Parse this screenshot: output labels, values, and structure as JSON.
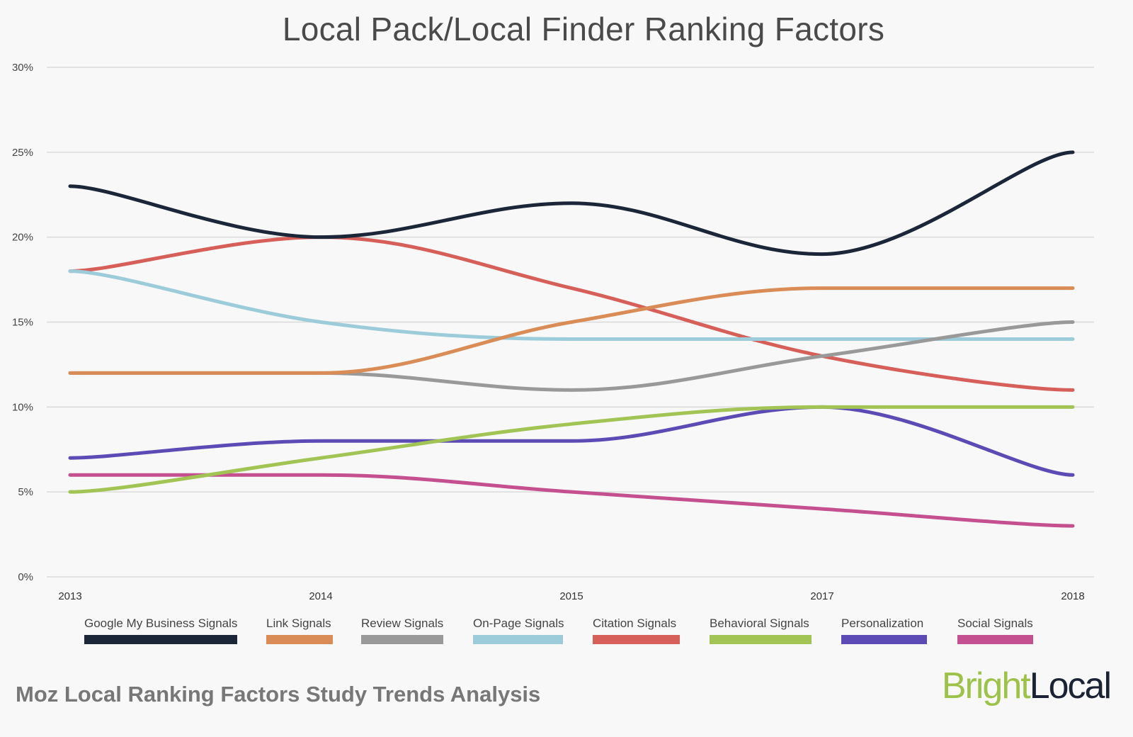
{
  "chart_data": {
    "type": "line",
    "title": "Local Pack/Local Finder Ranking Factors",
    "subtitle": "Moz Local Ranking Factors Study Trends Analysis",
    "xlabel": "",
    "ylabel": "",
    "x": [
      "2013",
      "2014",
      "2015",
      "2017",
      "2018"
    ],
    "y_ticks": [
      "0%",
      "5%",
      "10%",
      "15%",
      "20%",
      "25%",
      "30%"
    ],
    "y_tick_values": [
      0,
      5,
      10,
      15,
      20,
      25,
      30
    ],
    "ylim": [
      0,
      30
    ],
    "grid": true,
    "smooth": true,
    "legend_position": "bottom",
    "series": [
      {
        "name": "Google My Business Signals",
        "color": "#1b2638",
        "values": [
          23,
          20,
          22,
          19,
          25
        ]
      },
      {
        "name": "Link Signals",
        "color": "#d98c56",
        "values": [
          12,
          12,
          15,
          17,
          17
        ]
      },
      {
        "name": "Review Signals",
        "color": "#999999",
        "values": [
          12,
          12,
          11,
          13,
          15
        ]
      },
      {
        "name": "On-Page Signals",
        "color": "#9ccbd9",
        "values": [
          18,
          15,
          14,
          14,
          14
        ]
      },
      {
        "name": "Citation Signals",
        "color": "#d65f5a",
        "values": [
          18,
          20,
          17,
          13,
          11
        ]
      },
      {
        "name": "Behavioral Signals",
        "color": "#a2c455",
        "values": [
          5,
          7,
          9,
          10,
          10
        ]
      },
      {
        "name": "Personalization",
        "color": "#5d4bb5",
        "values": [
          7,
          8,
          8,
          10,
          6
        ]
      },
      {
        "name": "Social Signals",
        "color": "#c4508f",
        "values": [
          6,
          6,
          5,
          4,
          3
        ]
      }
    ]
  },
  "footer": {
    "subtitle": "Moz Local Ranking Factors Study Trends Analysis",
    "brand_part1": "Bright",
    "brand_part2": "Local"
  }
}
